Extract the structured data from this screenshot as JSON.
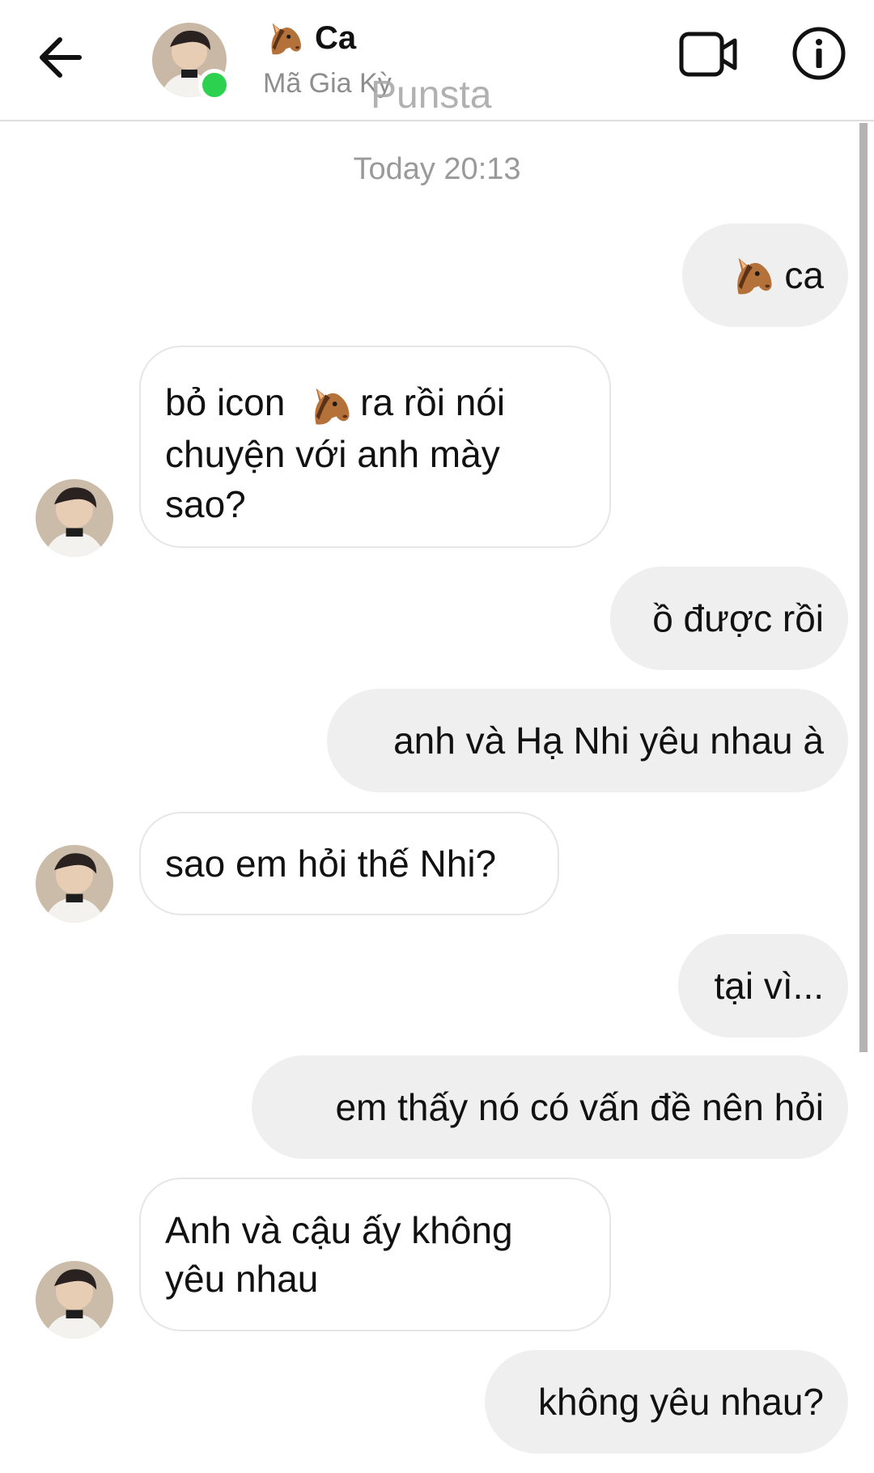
{
  "header": {
    "title": "Ca",
    "subtitle": "Mã Gia Kỳ",
    "watermark": "Punsta",
    "icons": {
      "back": "arrow-left-icon",
      "video": "video-camera-icon",
      "info": "info-icon",
      "title_emoji": "horse-face-emoji"
    },
    "online": true
  },
  "timestamp": "Today 20:13",
  "messages": [
    {
      "side": "sent",
      "emoji": "horse-face-emoji",
      "text": "ca"
    },
    {
      "side": "received",
      "text_before": "bỏ icon",
      "emoji": "horse-face-emoji",
      "text_after": "ra rồi nói\nchuyện với anh mày\nsao?"
    },
    {
      "side": "sent",
      "text": "ồ được rồi"
    },
    {
      "side": "sent",
      "text": "anh và Hạ Nhi yêu nhau à"
    },
    {
      "side": "received",
      "text": "sao em hỏi thế Nhi?"
    },
    {
      "side": "sent",
      "text": "tại vì..."
    },
    {
      "side": "sent",
      "text": "em thấy nó có vấn đề nên hỏi"
    },
    {
      "side": "received",
      "text": "Anh và cậu ấy không\nyêu nhau"
    },
    {
      "side": "sent",
      "text": "không yêu nhau?"
    }
  ],
  "colors": {
    "sent_bubble": "#efefef",
    "received_border": "#e6e6e6",
    "online_dot": "#2bd14f",
    "timestamp": "#9a9a9a"
  }
}
